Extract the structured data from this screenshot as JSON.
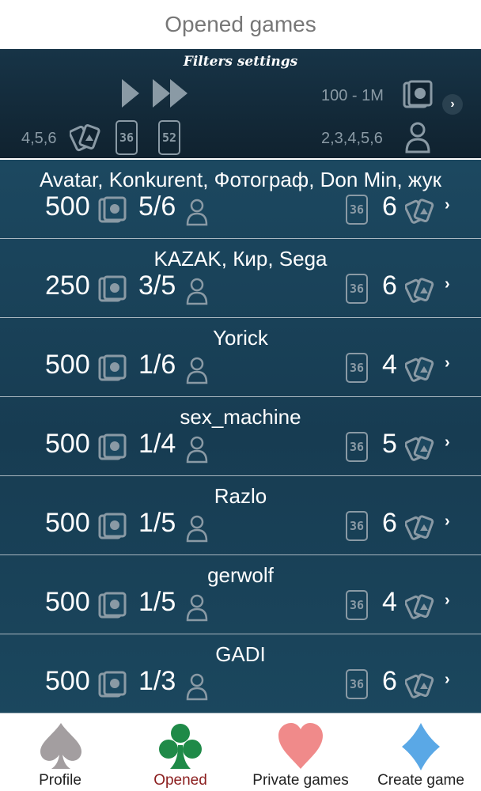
{
  "header": {
    "title": "Opened games"
  },
  "filters": {
    "title": "Filters settings",
    "stake_range": "100 - 1M",
    "cards": "4,5,6",
    "decks": [
      "36",
      "52"
    ],
    "players": "2,3,4,5,6"
  },
  "games": [
    {
      "players": "Avatar, Konkurent, Фотограф, Don Min, жук",
      "stake": "500",
      "seats": "5/6",
      "deck": "36",
      "cards": "6"
    },
    {
      "players": "KAZAK, Кир, Sega",
      "stake": "250",
      "seats": "3/5",
      "deck": "36",
      "cards": "6"
    },
    {
      "players": "Yorick",
      "stake": "500",
      "seats": "1/6",
      "deck": "36",
      "cards": "4"
    },
    {
      "players": "sex_machine",
      "stake": "500",
      "seats": "1/4",
      "deck": "36",
      "cards": "5"
    },
    {
      "players": "Razlo",
      "stake": "500",
      "seats": "1/5",
      "deck": "36",
      "cards": "6"
    },
    {
      "players": "gerwolf",
      "stake": "500",
      "seats": "1/5",
      "deck": "36",
      "cards": "4"
    },
    {
      "players": "GADI",
      "stake": "500",
      "seats": "1/3",
      "deck": "36",
      "cards": "6"
    }
  ],
  "tabs": [
    {
      "label": "Profile",
      "icon": "spade-icon",
      "color": "#a39ea0",
      "active": false
    },
    {
      "label": "Opened",
      "icon": "club-icon",
      "color": "#1f8a48",
      "active": true
    },
    {
      "label": "Private games",
      "icon": "heart-icon",
      "color": "#f08a8a",
      "active": false
    },
    {
      "label": "Create game",
      "icon": "diamond-icon",
      "color": "#5aa8e6",
      "active": false
    }
  ],
  "colors": {
    "panel_dark": "#10222f",
    "list_bg": "#1c4860",
    "icon_muted": "#8a9aa5",
    "active_tab": "#8b1e1e"
  }
}
